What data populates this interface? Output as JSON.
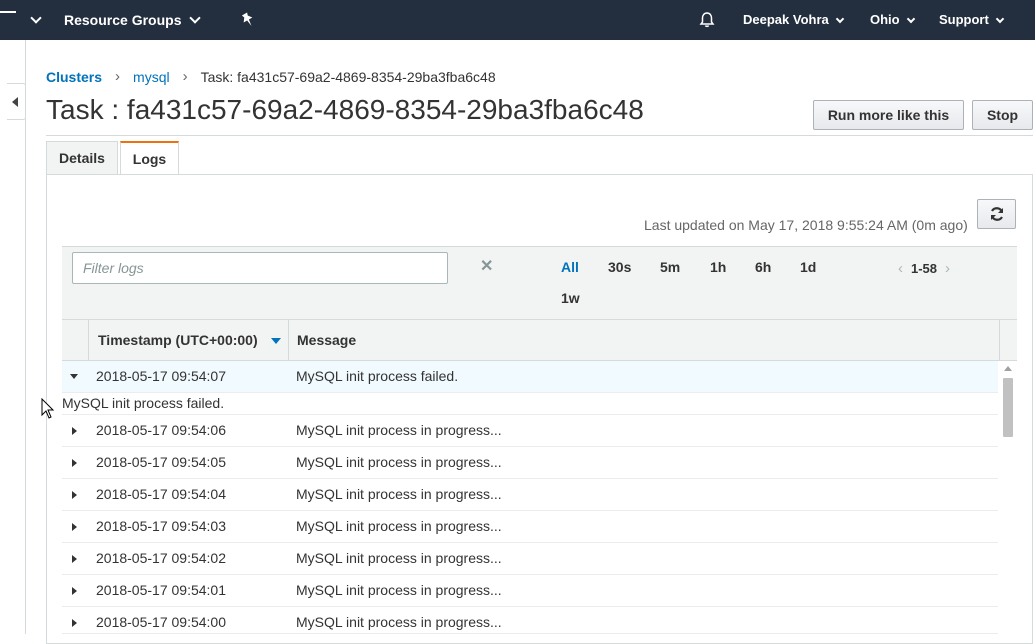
{
  "nav": {
    "resource_groups": "Resource Groups",
    "user": "Deepak Vohra",
    "region": "Ohio",
    "support": "Support",
    "icons": [
      "menu-chevron-icon",
      "pin-icon",
      "bell-icon"
    ]
  },
  "breadcrumb": {
    "clusters": "Clusters",
    "cluster": "mysql",
    "current": "Task: fa431c57-69a2-4869-8354-29ba3fba6c48"
  },
  "page": {
    "title": "Task : fa431c57-69a2-4869-8354-29ba3fba6c48",
    "run_more_label": "Run more like this",
    "stop_label": "Stop"
  },
  "tabs": [
    {
      "label": "Details",
      "active": false
    },
    {
      "label": "Logs",
      "active": true
    }
  ],
  "logs": {
    "last_updated": "Last updated on May 17, 2018 9:55:24 AM (0m ago)",
    "filter_placeholder": "Filter logs",
    "ranges": [
      "All",
      "30s",
      "5m",
      "1h",
      "6h",
      "1d",
      "1w"
    ],
    "active_range": "All",
    "pager": "1-58",
    "columns": {
      "timestamp": "Timestamp (UTC+00:00)",
      "message": "Message"
    },
    "expanded_detail": "MySQL init process failed.",
    "rows": [
      {
        "timestamp": "2018-05-17 09:54:07",
        "message": "MySQL init process failed.",
        "expanded": true
      },
      {
        "timestamp": "2018-05-17 09:54:06",
        "message": "MySQL init process in progress...",
        "expanded": false
      },
      {
        "timestamp": "2018-05-17 09:54:05",
        "message": "MySQL init process in progress...",
        "expanded": false
      },
      {
        "timestamp": "2018-05-17 09:54:04",
        "message": "MySQL init process in progress...",
        "expanded": false
      },
      {
        "timestamp": "2018-05-17 09:54:03",
        "message": "MySQL init process in progress...",
        "expanded": false
      },
      {
        "timestamp": "2018-05-17 09:54:02",
        "message": "MySQL init process in progress...",
        "expanded": false
      },
      {
        "timestamp": "2018-05-17 09:54:01",
        "message": "MySQL init process in progress...",
        "expanded": false
      },
      {
        "timestamp": "2018-05-17 09:54:00",
        "message": "MySQL init process in progress...",
        "expanded": false
      }
    ]
  },
  "colors": {
    "nav_bg": "#232f3e",
    "link": "#0073bb",
    "tab_accent": "#ec7211",
    "selected_row": "#f1faff"
  }
}
